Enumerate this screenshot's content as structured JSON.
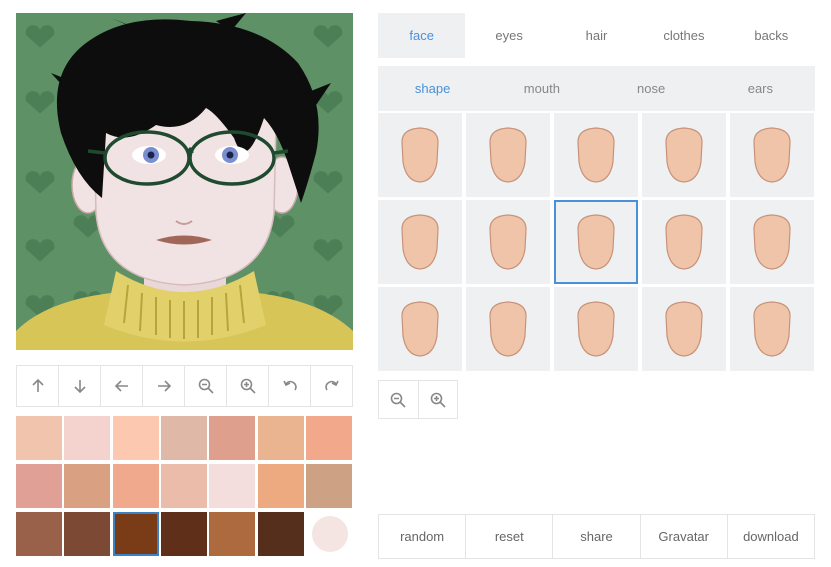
{
  "avatar": {
    "background_color": "#5e9266",
    "pattern_icon": "heart-icon",
    "hair_color": "#0d0d0d",
    "skin_color": "#f1e3e3",
    "eye_color": "#7a8fd0",
    "glasses_color": "#1f4a30",
    "sweater_color": "#d8c558",
    "lip_color": "#a06658"
  },
  "toolbar": {
    "buttons": [
      {
        "icon": "arrow-up-icon"
      },
      {
        "icon": "arrow-down-icon"
      },
      {
        "icon": "arrow-left-icon"
      },
      {
        "icon": "arrow-right-icon"
      },
      {
        "icon": "zoom-out-icon"
      },
      {
        "icon": "zoom-in-icon"
      },
      {
        "icon": "rotate-left-icon"
      },
      {
        "icon": "rotate-right-icon"
      }
    ]
  },
  "swatches": {
    "colors": [
      "#f0c4ad",
      "#f4d2cd",
      "#fdc8b0",
      "#e0b8a8",
      "#dea08c",
      "#ebb490",
      "#f2a88a",
      "#e1a096",
      "#d9a082",
      "#f0a98c",
      "#ecbcaa",
      "#f4dedd",
      "#edaa80",
      "#cda184",
      "#9a614a",
      "#7b4934",
      "#7a3c16",
      "#5f2f1a",
      "#ac6a3e",
      "#552f1c"
    ],
    "selected_index": 16,
    "extra_color": "#f4e4e2"
  },
  "categories": {
    "tabs": [
      "face",
      "eyes",
      "hair",
      "clothes",
      "backs"
    ],
    "active_index": 0
  },
  "subcategories": {
    "tabs": [
      "shape",
      "mouth",
      "nose",
      "ears"
    ],
    "active_index": 0
  },
  "options": {
    "count": 15,
    "selected_index": 7,
    "face_color": "#f0c4a8",
    "face_stroke": "#c8927a"
  },
  "zoom": {
    "buttons": [
      {
        "icon": "zoom-out-icon"
      },
      {
        "icon": "zoom-in-icon"
      }
    ]
  },
  "actions": {
    "random": "random",
    "reset": "reset",
    "share": "share",
    "gravatar": "Gravatar",
    "download": "download"
  }
}
